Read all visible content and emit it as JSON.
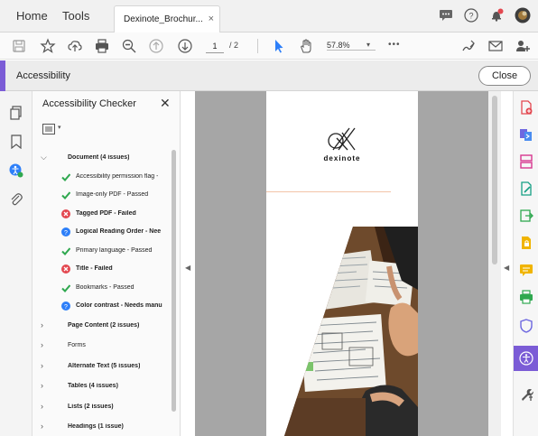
{
  "menubar": {
    "home_label": "Home",
    "tools_label": "Tools",
    "doc_tab_label": "Dexinote_Brochur...",
    "doc_tab_close": "×"
  },
  "toolbar": {
    "page_current": "1",
    "page_total": "/ 2",
    "zoom": "57.8%",
    "zoom_caret": "▾",
    "more": "•••"
  },
  "accessibility_bar": {
    "title": "Accessibility",
    "close_label": "Close",
    "accent_color": "#7b5cd6"
  },
  "checker": {
    "title": "Accessibility Checker",
    "close_glyph": "✕",
    "options_caret": "▾",
    "document_group": "Document (4 issues)",
    "document_items": [
      {
        "label": "Accessibility permission flag -",
        "status": "passed",
        "bold": false
      },
      {
        "label": "Image-only PDF - Passed",
        "status": "passed",
        "bold": false
      },
      {
        "label": "Tagged PDF - Failed",
        "status": "failed",
        "bold": true
      },
      {
        "label": "Logical Reading Order - Nee",
        "status": "needs-check",
        "bold": true
      },
      {
        "label": "Primary language - Passed",
        "status": "passed",
        "bold": false
      },
      {
        "label": "Title - Failed",
        "status": "failed",
        "bold": true
      },
      {
        "label": "Bookmarks - Passed",
        "status": "passed",
        "bold": false
      },
      {
        "label": "Color contrast - Needs manu",
        "status": "needs-check",
        "bold": true
      }
    ],
    "groups": [
      {
        "label": "Page Content (2 issues)",
        "bold": true
      },
      {
        "label": "Forms",
        "bold": false
      },
      {
        "label": "Alternate Text (5 issues)",
        "bold": true
      },
      {
        "label": "Tables (4 issues)",
        "bold": true
      },
      {
        "label": "Lists (2 issues)",
        "bold": true
      },
      {
        "label": "Headings (1 issue)",
        "bold": true
      }
    ],
    "status_colors": {
      "passed": "#2fa84f",
      "failed": "#e34850",
      "needs-check": "#2d7ff9"
    }
  },
  "document": {
    "brand_name": "dexinote"
  },
  "colors": {
    "page_bg": "#a6a6a6",
    "rule": "#f3c4a8"
  }
}
